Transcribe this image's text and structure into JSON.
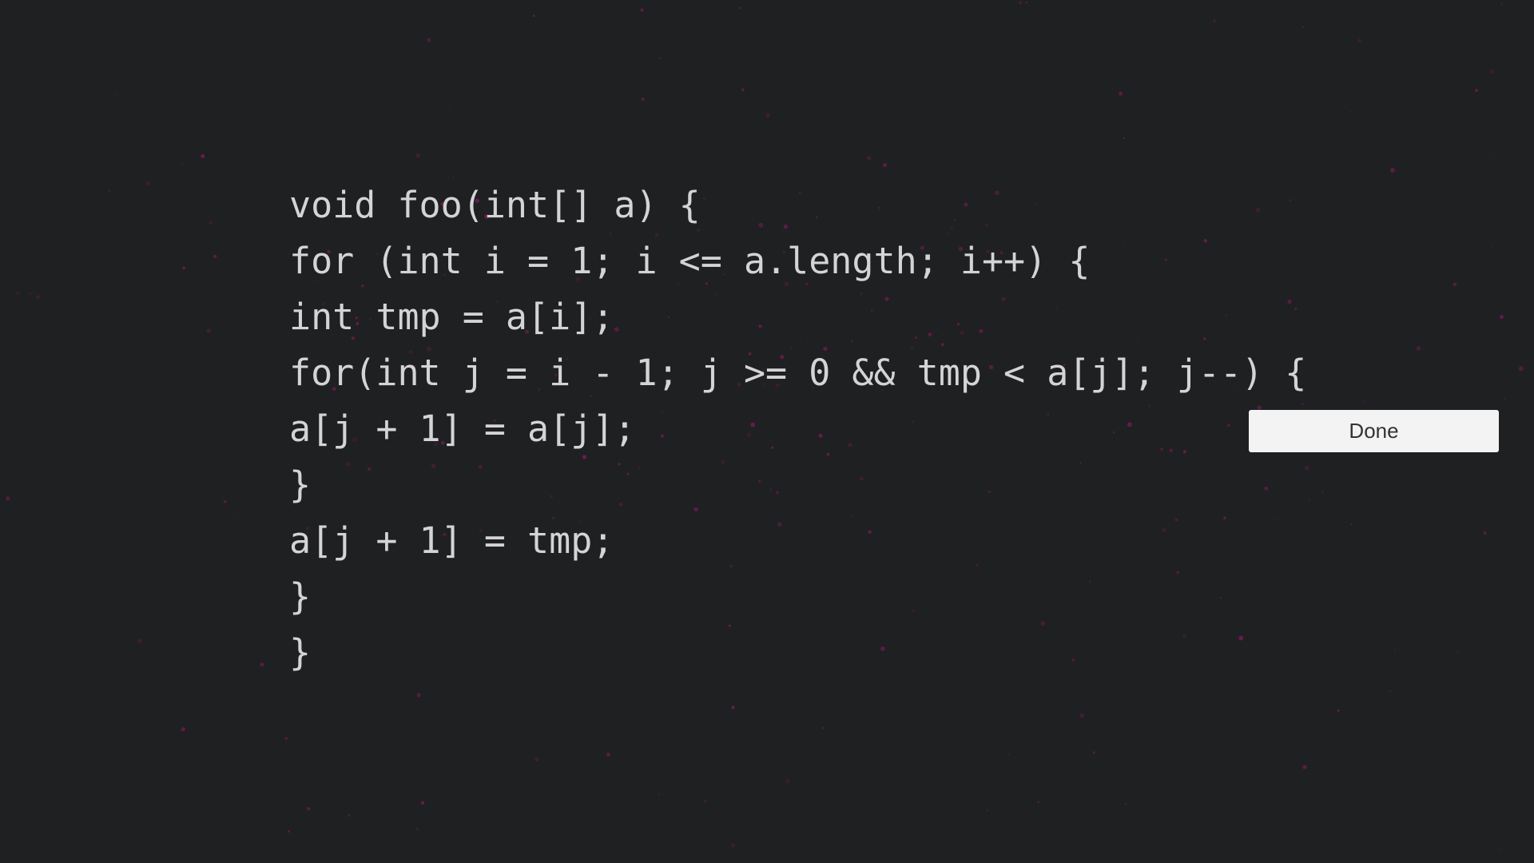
{
  "code": {
    "lines": [
      "void foo(int[] a) {",
      "for (int i = 1; i <= a.length; i++) {",
      "int tmp = a[i];",
      "for(int j = i - 1; j >= 0 && tmp < a[j]; j--) {",
      "a[j + 1] = a[j];",
      "}",
      "a[j + 1] = tmp;",
      "}",
      "}"
    ]
  },
  "done_button": {
    "label": "Done"
  },
  "colors": {
    "background": "#1f2022",
    "code_text": "#d4d4d4",
    "button_bg": "#f3f3f3",
    "button_text": "#333333",
    "particles": "#c0157f"
  }
}
